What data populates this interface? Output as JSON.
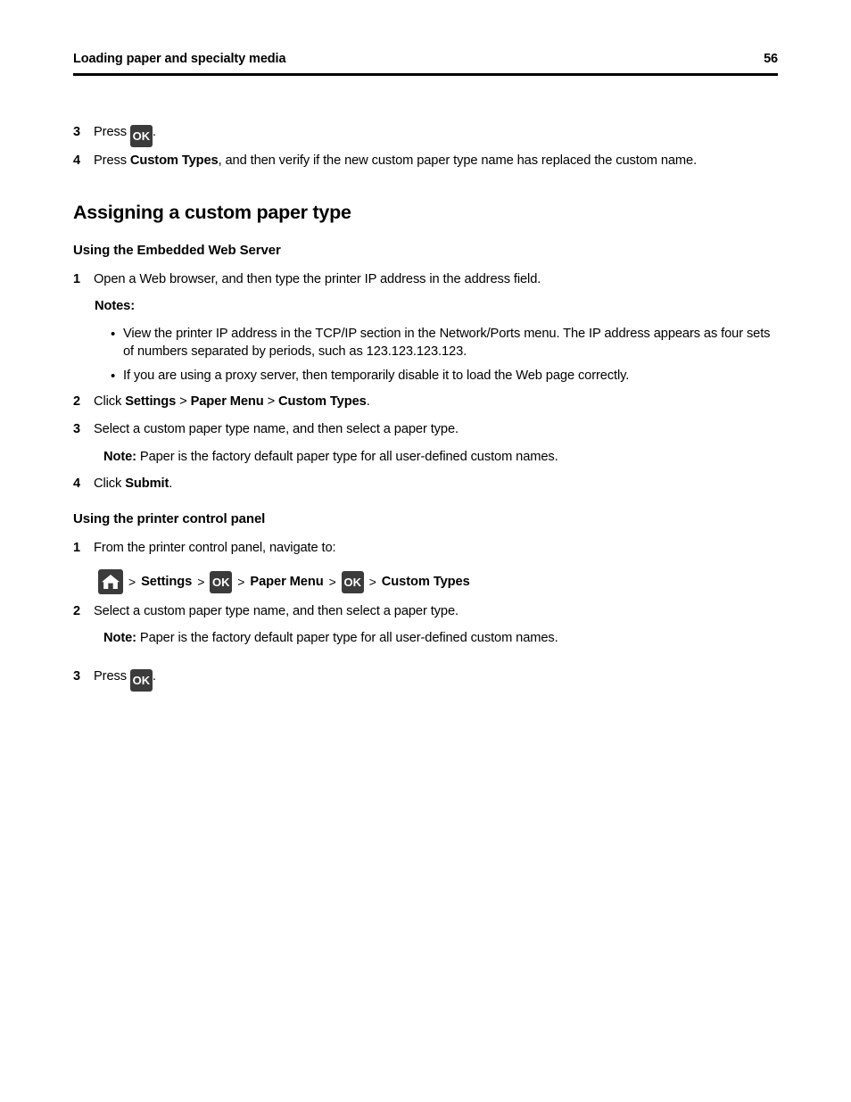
{
  "header": {
    "title": "Loading paper and specialty media",
    "page_number": "56"
  },
  "icons": {
    "ok_label": "OK",
    "home_name": "home-icon"
  },
  "colors": {
    "chip_background": "#3b3b3b",
    "chip_text": "#ffffff",
    "text": "#000000",
    "page_background": "#ffffff"
  },
  "top_steps": [
    {
      "number": "3",
      "prefix": "Press ",
      "suffix": "."
    },
    {
      "number": "4",
      "text_before": "Press ",
      "bold": "Custom Types",
      "text_after": ", and then verify if the new custom paper type name has replaced the custom name."
    }
  ],
  "section": {
    "heading": "Assigning a custom paper type",
    "web_server": {
      "heading": "Using the Embedded Web Server",
      "step1": {
        "number": "1",
        "text": "Open a Web browser, and then type the printer IP address in the address field."
      },
      "notes_label": "Notes:",
      "bullets": [
        "View the printer IP address in the TCP/IP section in the Network/Ports menu. The IP address appears as four sets of numbers separated by periods, such as 123.123.123.123.",
        "If you are using a proxy server, then temporarily disable it to load the Web page correctly."
      ],
      "step2": {
        "number": "2",
        "text_before": "Click ",
        "bold1": "Settings",
        "sep1": " > ",
        "bold2": "Paper Menu",
        "sep2": " > ",
        "bold3": "Custom Types",
        "text_after": "."
      },
      "step3": {
        "number": "3",
        "text": "Select a custom paper type name, and then select a paper type."
      },
      "note": {
        "label": "Note:",
        "text": " Paper is the factory default paper type for all user-defined custom names."
      },
      "step4": {
        "number": "4",
        "text_before": "Click ",
        "bold": "Submit",
        "text_after": "."
      }
    },
    "control_panel": {
      "heading": "Using the printer control panel",
      "step1": {
        "number": "1",
        "text": "From the printer control panel, navigate to:"
      },
      "navpath": {
        "sep": ">",
        "item_settings": "Settings",
        "item_paper_menu": "Paper Menu",
        "item_custom_types": "Custom Types"
      },
      "step2": {
        "number": "2",
        "text": "Select a custom paper type name, and then select a paper type."
      },
      "note": {
        "label": "Note:",
        "text": " Paper is the factory default paper type for all user-defined custom names."
      },
      "step3": {
        "number": "3",
        "prefix": "Press ",
        "suffix": "."
      }
    }
  }
}
